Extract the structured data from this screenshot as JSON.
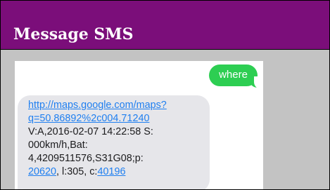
{
  "header": {
    "title": "Message SMS"
  },
  "colors": {
    "header_bg": "#7b0e7a",
    "page_bg": "#c3c3c3",
    "sent_bubble": "#2dce52",
    "received_bubble": "#e6e6ea",
    "link": "#1f7ff0"
  },
  "sms": {
    "sent": {
      "text": "where"
    },
    "received": {
      "link_line1": "http://maps.google.com/maps?",
      "link_line2": "q=50.86892%2c004.71240",
      "line3": "V:A,2016-02-07 14:22:58 S:",
      "line4": "000km/h,Bat:",
      "line5": "4,4209511576,S31G08;p:",
      "line6_link1": "20620",
      "line6_mid": ", l:305, c:",
      "line6_link2": "40196"
    }
  }
}
